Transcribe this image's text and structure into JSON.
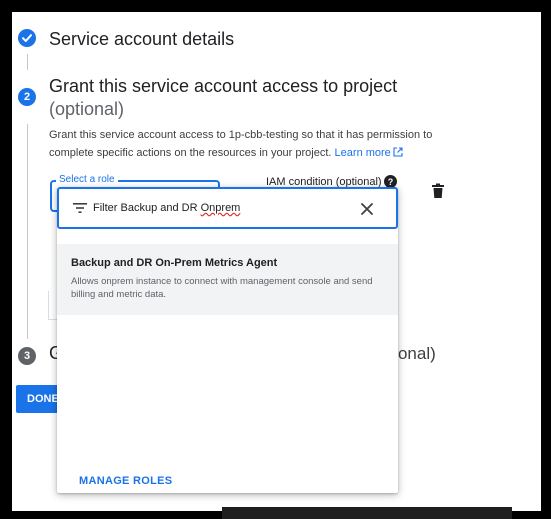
{
  "steps": [
    {
      "number": "1",
      "title": "Service account details",
      "state": "done"
    },
    {
      "number": "2",
      "title": "Grant this service account access to project",
      "optional": "(optional)",
      "state": "active"
    },
    {
      "number": "3",
      "title": "G",
      "optional_tail": "otional)",
      "state": "pending"
    }
  ],
  "grant": {
    "description": "Grant this service account access to 1p-cbb-testing so that it has permission to complete specific actions on the resources in your project.",
    "learn_more": "Learn more"
  },
  "role_field": {
    "label": "Select a role"
  },
  "iam_condition": {
    "label": "IAM condition (optional)",
    "help": "?"
  },
  "done_button": {
    "label": "DONE"
  },
  "dropdown": {
    "filter_prefix": "Filter Backup and DR ",
    "filter_underlined": "Onprem",
    "results": [
      {
        "title": "Backup and DR On-Prem Metrics Agent",
        "description": "Allows onprem instance to connect with management console and send billing and metric data."
      }
    ],
    "manage_roles": "MANAGE ROLES"
  },
  "colors": {
    "accent": "#1a73e8",
    "text": "#202124",
    "muted": "#5f6368",
    "selected_bg": "#f1f3f4"
  },
  "icons": [
    "check-icon",
    "external-link-icon",
    "help-icon",
    "trash-icon",
    "filter-icon",
    "close-icon"
  ]
}
